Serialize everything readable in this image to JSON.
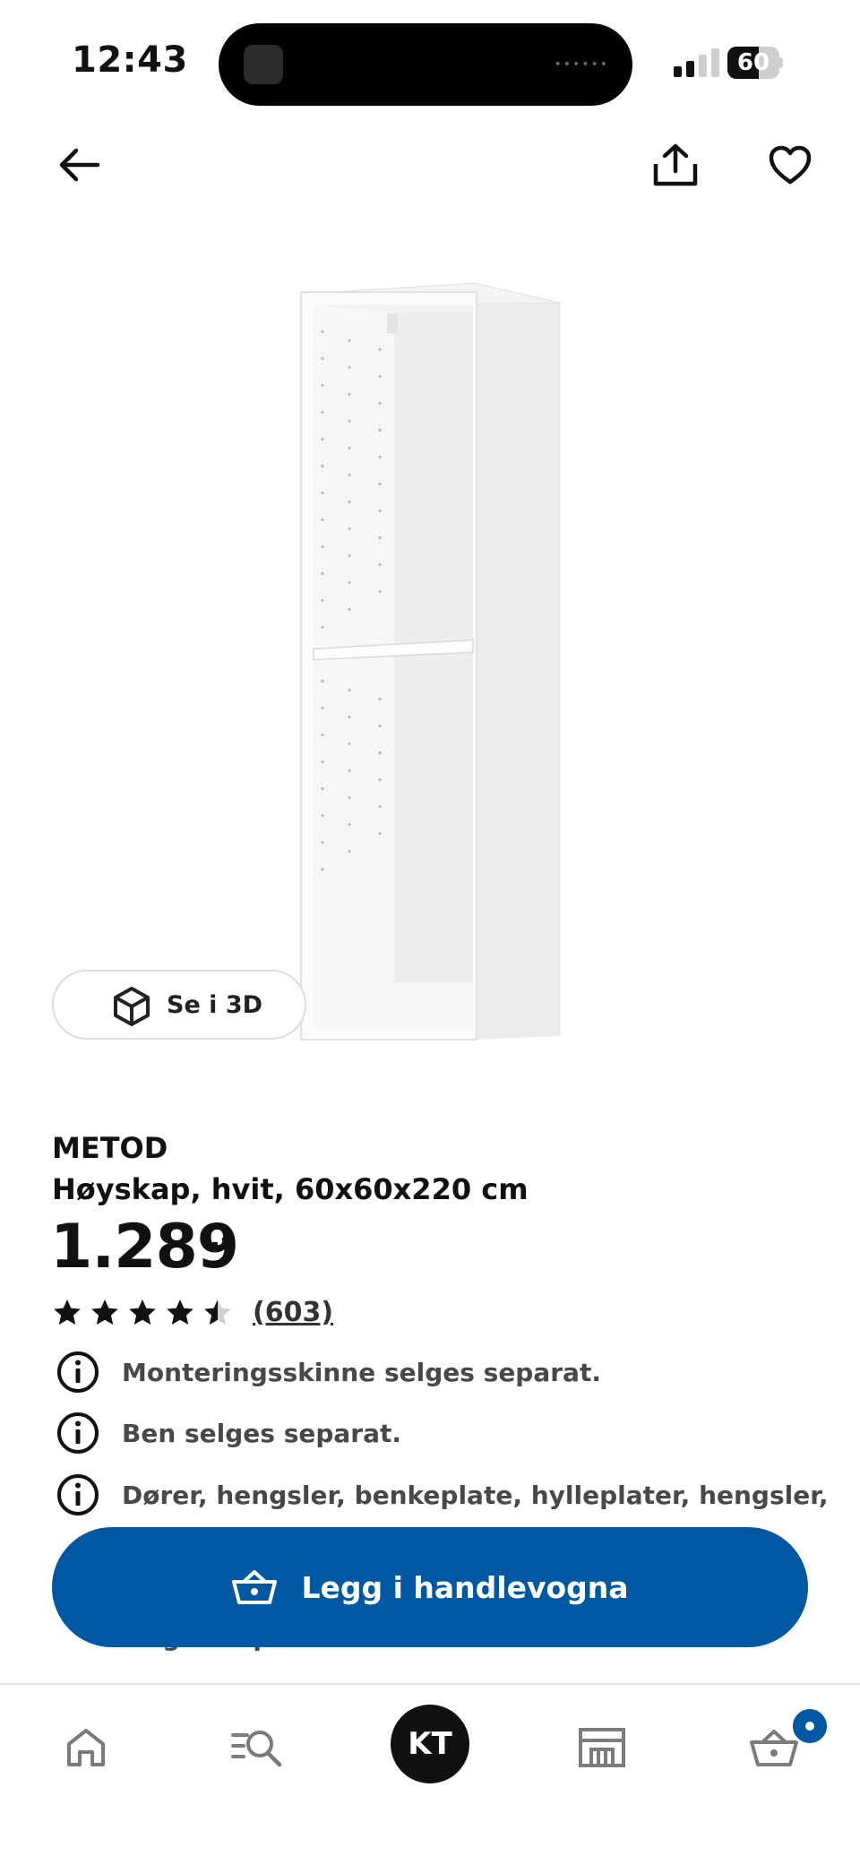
{
  "status_bar": {
    "time": "12:43",
    "battery_level": "60",
    "battery_fraction": 0.6,
    "signal_bars_active": 2,
    "signal_bars_total": 4
  },
  "header": {
    "back_icon": "arrow-left-icon",
    "share_icon": "share-icon",
    "favorite_icon": "heart-icon"
  },
  "product": {
    "view_3d_label": "Se i 3D",
    "brand": "METOD",
    "description": "Høyskap, hvit, 60x60x220 cm",
    "price": "1.289",
    "price_suffix": ",–",
    "rating": {
      "value": 4.5,
      "max": 5,
      "count": "(603)"
    },
    "notices": [
      "Monteringsskinne selges separat.",
      "Ben selges separat.",
      "Dører, hengsler, benkeplate, hylleplater, hengsler,",
      "selges separat."
    ]
  },
  "cart_button": {
    "label": "Legg i handlevogna",
    "icon": "shopping-basket-icon"
  },
  "bottom_nav": {
    "items": [
      "home-icon",
      "search-list-icon",
      "profile-avatar",
      "store-icon",
      "cart-icon"
    ],
    "avatar_initials": "KT"
  },
  "colors": {
    "accent": "#0058a3",
    "text": "#111111",
    "secondary_text": "#484848"
  }
}
